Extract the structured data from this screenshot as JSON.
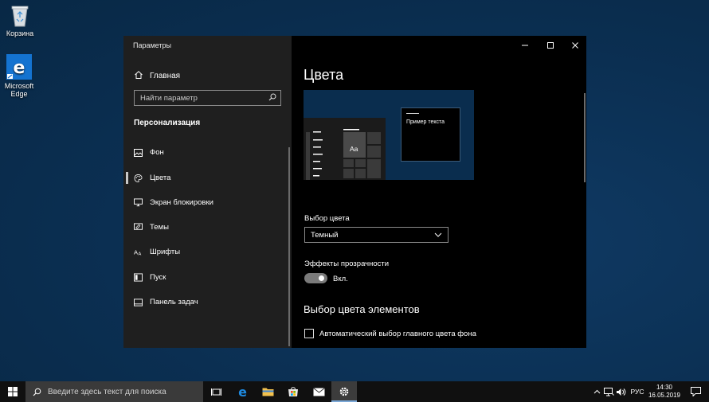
{
  "desktop": {
    "icons": [
      {
        "label": "Корзина"
      },
      {
        "label": "Microsoft Edge"
      }
    ]
  },
  "window": {
    "app_title": "Параметры",
    "sidebar": {
      "home_label": "Главная",
      "search_placeholder": "Найти параметр",
      "section_title": "Персонализация",
      "items": [
        {
          "label": "Фон",
          "icon": "picture-icon"
        },
        {
          "label": "Цвета",
          "icon": "palette-icon",
          "selected": true
        },
        {
          "label": "Экран блокировки",
          "icon": "monitor-icon"
        },
        {
          "label": "Темы",
          "icon": "brush-icon"
        },
        {
          "label": "Шрифты",
          "icon": "font-icon"
        },
        {
          "label": "Пуск",
          "icon": "start-icon"
        },
        {
          "label": "Панель задач",
          "icon": "taskbar-icon"
        }
      ]
    },
    "main": {
      "title": "Цвета",
      "preview": {
        "sample_text": "Пример текста",
        "tile_text": "Aa"
      },
      "color_choice_label": "Выбор цвета",
      "color_choice_value": "Темный",
      "transparency_label": "Эффекты прозрачности",
      "transparency_state": "Вкл.",
      "transparency_on": true,
      "accent_heading": "Выбор цвета элементов",
      "auto_accent_label": "Автоматический выбор главного цвета фона",
      "auto_accent_checked": false
    }
  },
  "taskbar": {
    "search_placeholder": "Введите здесь текст для поиска",
    "pinned": [
      "task-view-icon",
      "edge-icon",
      "file-explorer-icon",
      "store-icon",
      "mail-icon",
      "settings-icon"
    ],
    "active": "settings-icon",
    "language": "РУС",
    "time": "14:30",
    "date": "16.05.2019"
  },
  "colors": {
    "desktop": "#0b2f52",
    "sidebar": "#1f1f1f",
    "content": "#000000",
    "taskbar": "#101010",
    "accent_blue": "#1e6fb8"
  }
}
